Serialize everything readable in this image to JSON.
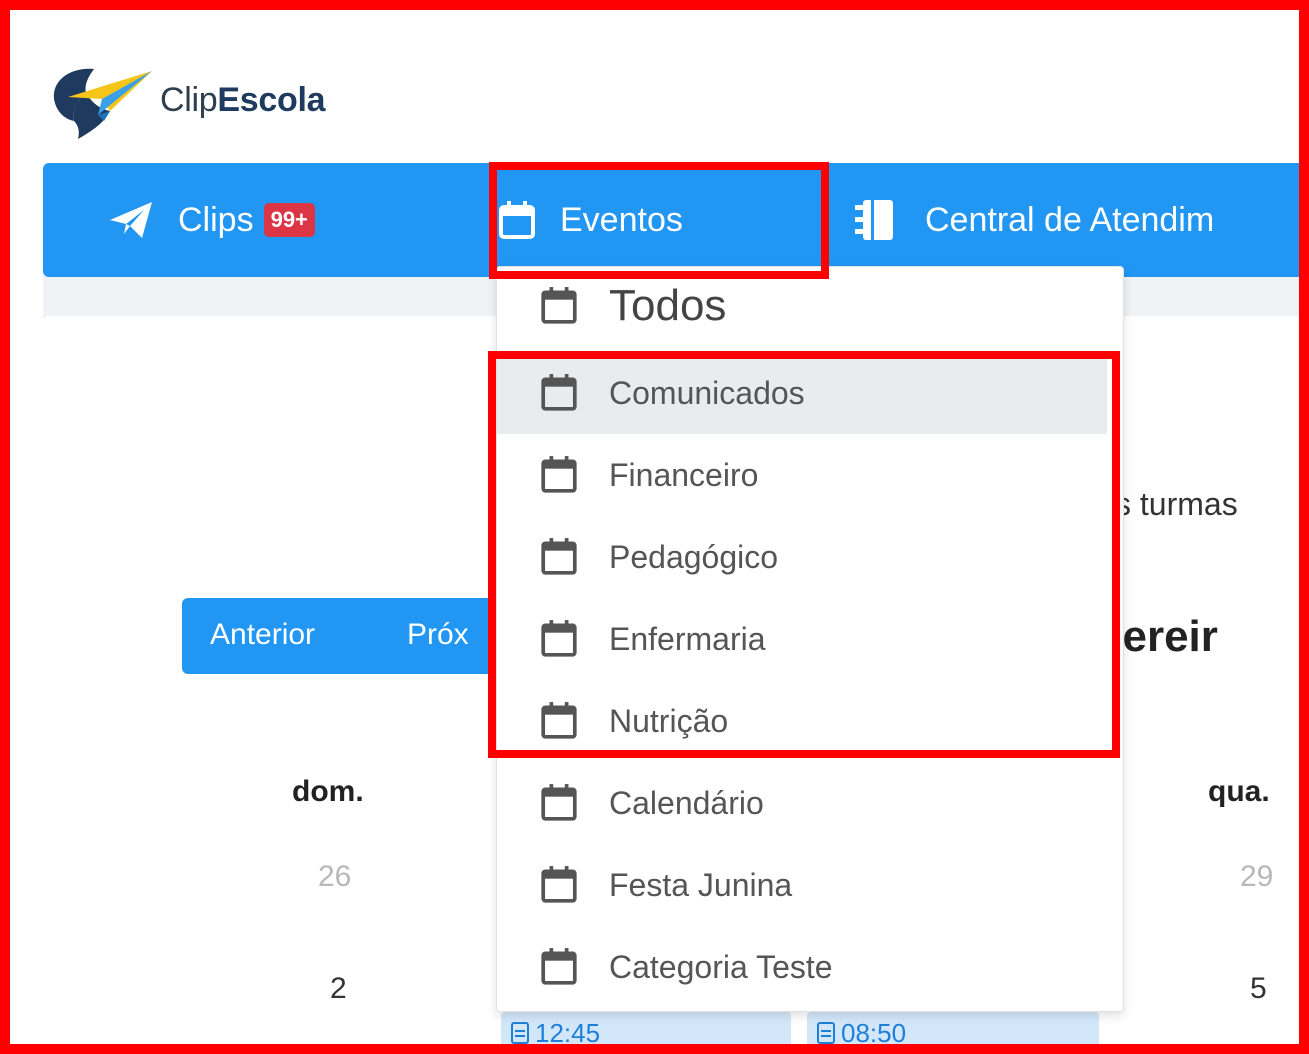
{
  "brand": {
    "name_light": "Clip",
    "name_bold": "Escola"
  },
  "colors": {
    "primary": "#2196f3",
    "badge": "#dc3545",
    "highlight_box": "#ff0000",
    "dropdown_active": "#e9ecef"
  },
  "nav": {
    "clips": {
      "label": "Clips",
      "badge": "99+",
      "icon": "paper-plane-icon"
    },
    "eventos": {
      "label": "Eventos",
      "icon": "calendar-icon"
    },
    "central": {
      "label": "Central de Atendim",
      "icon": "address-book-icon"
    }
  },
  "dropdown": {
    "items": [
      {
        "label": "Todos"
      },
      {
        "label": "Comunicados",
        "active": true
      },
      {
        "label": "Financeiro"
      },
      {
        "label": "Pedagógico"
      },
      {
        "label": "Enfermaria"
      },
      {
        "label": "Nutrição"
      },
      {
        "label": "Calendário"
      },
      {
        "label": "Festa Junina"
      },
      {
        "label": "Categoria Teste"
      }
    ]
  },
  "calendar": {
    "filter_text_fragment": "s turmas",
    "month_title_fragment": "vereir",
    "buttons": {
      "prev": "Anterior",
      "next_fragment": "Próx"
    },
    "weekdays": {
      "sun": "dom.",
      "wed": "qua."
    },
    "days": {
      "r1_sun": "26",
      "r1_wed": "29",
      "r2_sun": "2",
      "r2_wed": "5"
    },
    "events": [
      {
        "time": "12:45"
      },
      {
        "time": "08:50"
      }
    ]
  }
}
